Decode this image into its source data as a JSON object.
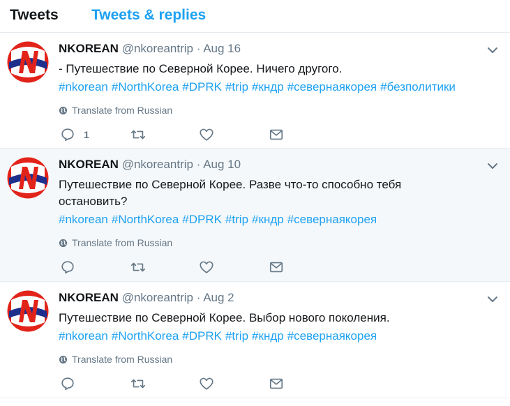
{
  "tabs": [
    {
      "label": "Tweets"
    },
    {
      "label": "Tweets & replies"
    }
  ],
  "colors": {
    "accent": "#1da1f2",
    "muted": "#657786",
    "logo_red": "#e2231a",
    "logo_navy": "#1e2f8c"
  },
  "tweets": [
    {
      "name": "NKOREAN",
      "handle": "@nkoreantrip",
      "separator": "·",
      "date": "Aug 16",
      "lines": [
        "- Путешествие по Северной Корее. Ничего другого."
      ],
      "hashtags": [
        "#nkorean",
        "#NorthKorea",
        "#DPRK",
        "#trip",
        "#кндр",
        "#севернаякорея",
        "#безполитики"
      ],
      "translate": "Translate from Russian",
      "reply_count": "1"
    },
    {
      "name": "NKOREAN",
      "handle": "@nkoreantrip",
      "separator": "·",
      "date": "Aug 10",
      "lines": [
        "Путешествие по Северной Корее. Разве что-то способно тебя",
        "остановить?"
      ],
      "hashtags": [
        "#nkorean",
        "#NorthKorea",
        "#DPRK",
        "#trip",
        "#кндр",
        "#севернаякорея"
      ],
      "translate": "Translate from Russian",
      "reply_count": ""
    },
    {
      "name": "NKOREAN",
      "handle": "@nkoreantrip",
      "separator": "·",
      "date": "Aug 2",
      "lines": [
        "Путешествие по Северной Корее. Выбор нового поколения."
      ],
      "hashtags": [
        "#nkorean",
        "#NorthKorea",
        "#DPRK",
        "#trip",
        "#кндр",
        "#севернаякорея"
      ],
      "translate": "Translate from Russian",
      "reply_count": ""
    }
  ]
}
